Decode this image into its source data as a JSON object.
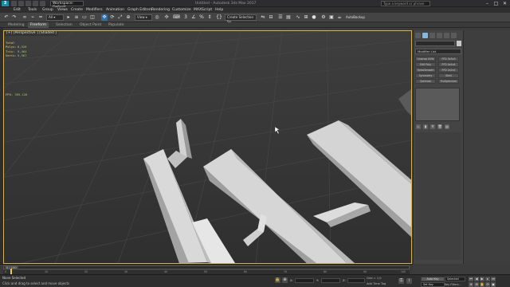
{
  "titlebar": {
    "logo": "3",
    "workspace": "Workspace: Default",
    "window_title": "Untitled - Autodesk 3ds Max 2017",
    "search_placeholder": "Type a keyword or phrase",
    "minimize": "–",
    "maximize": "□",
    "close": "✕"
  },
  "menu": {
    "items": [
      "Edit",
      "Tools",
      "Group",
      "Views",
      "Create",
      "Modifiers",
      "Animation",
      "Graph Editors",
      "Rendering",
      "Customize",
      "MAXScript",
      "Help"
    ]
  },
  "toolbar": {
    "view_dropdown": "View",
    "named_selection": "Create Selection Se",
    "autorecall": "AutoBackup"
  },
  "ribbon": {
    "tabs": [
      "Modeling",
      "Freeform",
      "Selection",
      "Object Paint",
      "Populate"
    ],
    "active_index": 1
  },
  "viewport": {
    "label": "[+] [Perspective ] [Shaded ]",
    "stats": [
      {
        "label": "Total",
        "value": ""
      },
      {
        "label": "Polys:",
        "value": "8,526"
      },
      {
        "label": "Tris:",
        "value": "9,464"
      },
      {
        "label": "Verts:",
        "value": "5,567"
      }
    ],
    "fps_label": "FPS:",
    "fps_value": "395.126",
    "border_color": "#d7b24c",
    "grid_color": "#4a4a4a",
    "background": "#3b3b3b"
  },
  "command_panel": {
    "modifier_list": "Modifier List",
    "buttons": [
      "Unwrap UVW",
      "FFD 3x3x3",
      "Edit Poly",
      "FFD 4x4x4",
      "TurboSmooth",
      "FFD 2x2x2",
      "Symmetry",
      "Shell",
      "Optimize",
      "ProOptimizer"
    ]
  },
  "timeline": {
    "slider_label": "0 / 100",
    "ticks": [
      "0",
      "10",
      "20",
      "30",
      "40",
      "50",
      "60",
      "70",
      "80",
      "90",
      "100"
    ]
  },
  "status": {
    "line1": "None Selected",
    "line2": "Click and drag to select and move objects",
    "x_label": "X:",
    "y_label": "Y:",
    "z_label": "Z:",
    "grid": "Grid = 1,0",
    "add_time_tag": "Add Time Tag",
    "autokey": "Auto Key",
    "setkey": "Set Key",
    "selected": "Selected",
    "key_filters": "Key Filters..."
  }
}
